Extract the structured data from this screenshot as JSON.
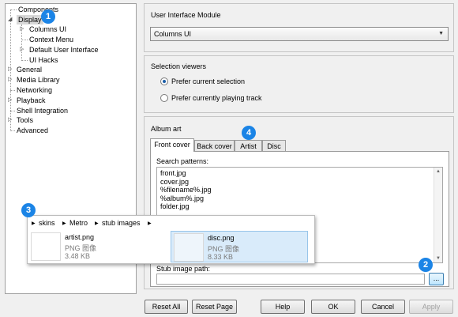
{
  "tree": {
    "items": [
      {
        "label": "Components"
      },
      {
        "label": "Display"
      },
      {
        "label": "Columns UI"
      },
      {
        "label": "Context Menu"
      },
      {
        "label": "Default User Interface"
      },
      {
        "label": "UI Hacks"
      },
      {
        "label": "General"
      },
      {
        "label": "Media Library"
      },
      {
        "label": "Networking"
      },
      {
        "label": "Playback"
      },
      {
        "label": "Shell Integration"
      },
      {
        "label": "Tools"
      },
      {
        "label": "Advanced"
      }
    ]
  },
  "ui_module": {
    "title": "User Interface Module",
    "selected": "Columns UI"
  },
  "selection_viewers": {
    "title": "Selection viewers",
    "options": [
      {
        "label": "Prefer current selection",
        "checked": true
      },
      {
        "label": "Prefer currently playing track",
        "checked": false
      }
    ]
  },
  "album_art": {
    "title": "Album art",
    "tabs": [
      "Front cover",
      "Back cover",
      "Artist",
      "Disc"
    ],
    "active_tab": "Front cover",
    "search_label": "Search patterns:",
    "patterns": [
      "front.jpg",
      "cover.jpg",
      "%filename%.jpg",
      "%album%.jpg",
      "folder.jpg"
    ],
    "stub_label": "Stub image path:",
    "stub_value": "",
    "browse_label": "..."
  },
  "buttons": {
    "reset_all": "Reset All",
    "reset_page": "Reset Page",
    "help": "Help",
    "ok": "OK",
    "cancel": "Cancel",
    "apply": "Apply"
  },
  "explorer": {
    "breadcrumb": [
      "skins",
      "Metro",
      "stub images"
    ],
    "files": [
      {
        "name": "artist.png",
        "type": "PNG 图像",
        "size": "3.48 KB"
      },
      {
        "name": "disc.png",
        "type": "PNG 图像",
        "size": "8.33 KB"
      }
    ]
  },
  "badges": [
    "1",
    "2",
    "3",
    "4"
  ]
}
